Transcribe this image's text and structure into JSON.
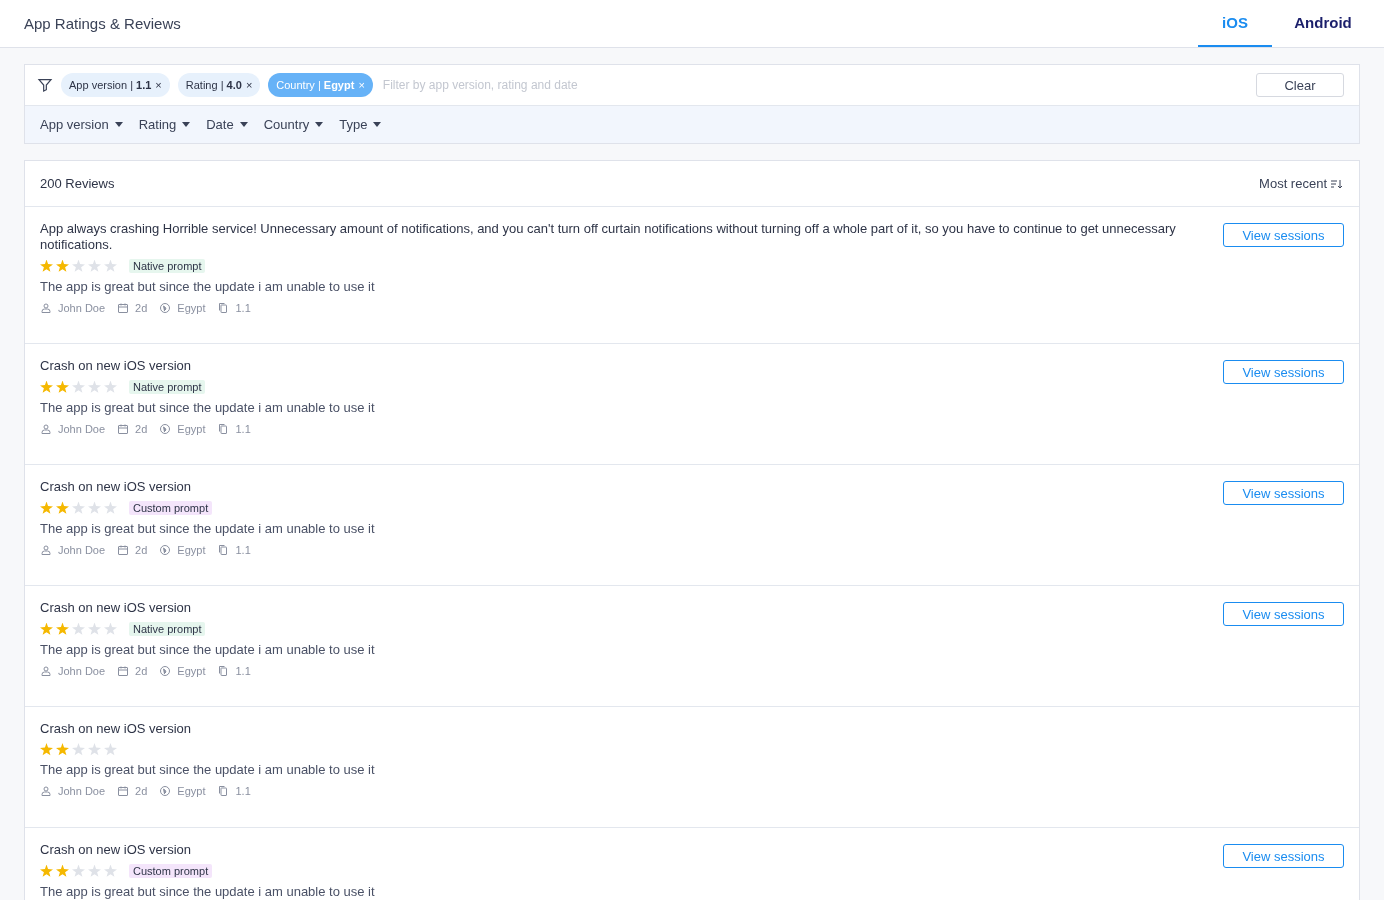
{
  "header": {
    "title": "App Ratings & Reviews",
    "tabs": [
      {
        "label": "iOS",
        "selected": true
      },
      {
        "label": "Android",
        "selected": false
      }
    ]
  },
  "filters": {
    "chips": [
      {
        "text": "App version | **1.1**",
        "active": false
      },
      {
        "text": "Rating | **4.0**",
        "active": false
      },
      {
        "text": "Country | **Egypt**",
        "active": true
      }
    ],
    "close_mark": "×",
    "placeholder": "Filter by app version, rating and date",
    "clear_button": "Clear",
    "dropdowns": [
      "App version",
      "Rating",
      "Date",
      "Country",
      "Type"
    ]
  },
  "reviews_panel": {
    "count": "200 Reviews",
    "sort": "Most recent",
    "reviews": [
      {
        "title": "App always crashing Horrible service! Unnecessary amount of notifications, and you can't turn off curtain notifications without turning off a whole part of it, so you have to continue to get unnecessary notifications.",
        "stars": 2,
        "tag": {
          "text": "Native prompt",
          "kind": "native"
        },
        "body": "The app is great but since the update i am unable to use it",
        "author": "John Doe",
        "age": "2d",
        "country": "Egypt",
        "version": "1.1",
        "button": "View sessions"
      },
      {
        "title": "Crash on new iOS version",
        "stars": 2,
        "tag": {
          "text": "Native prompt",
          "kind": "native"
        },
        "body": "The app is great but since the update i am unable to use it",
        "author": "John Doe",
        "age": "2d",
        "country": "Egypt",
        "version": "1.1",
        "button": "View sessions"
      },
      {
        "title": "Crash on new iOS version",
        "stars": 2,
        "tag": {
          "text": "Custom prompt",
          "kind": "custom"
        },
        "body": "The app is great but since the update i am unable to use it",
        "author": "John Doe",
        "age": "2d",
        "country": "Egypt",
        "version": "1.1",
        "button": "View sessions"
      },
      {
        "title": "Crash on new iOS version",
        "stars": 2,
        "tag": {
          "text": "Native prompt",
          "kind": "native"
        },
        "body": "The app is great but since the update i am unable to use it",
        "author": "John Doe",
        "age": "2d",
        "country": "Egypt",
        "version": "1.1",
        "button": "View sessions"
      },
      {
        "title": "Crash on new iOS version",
        "stars": 2,
        "body": "The app is great but since the update i am unable to use it",
        "author": "John Doe",
        "age": "2d",
        "country": "Egypt",
        "version": "1.1"
      },
      {
        "title": "Crash on new iOS version",
        "stars": 2,
        "tag": {
          "text": "Custom prompt",
          "kind": "custom"
        },
        "body": "The app is great but since the update i am unable to use it",
        "button": "View sessions"
      }
    ]
  }
}
